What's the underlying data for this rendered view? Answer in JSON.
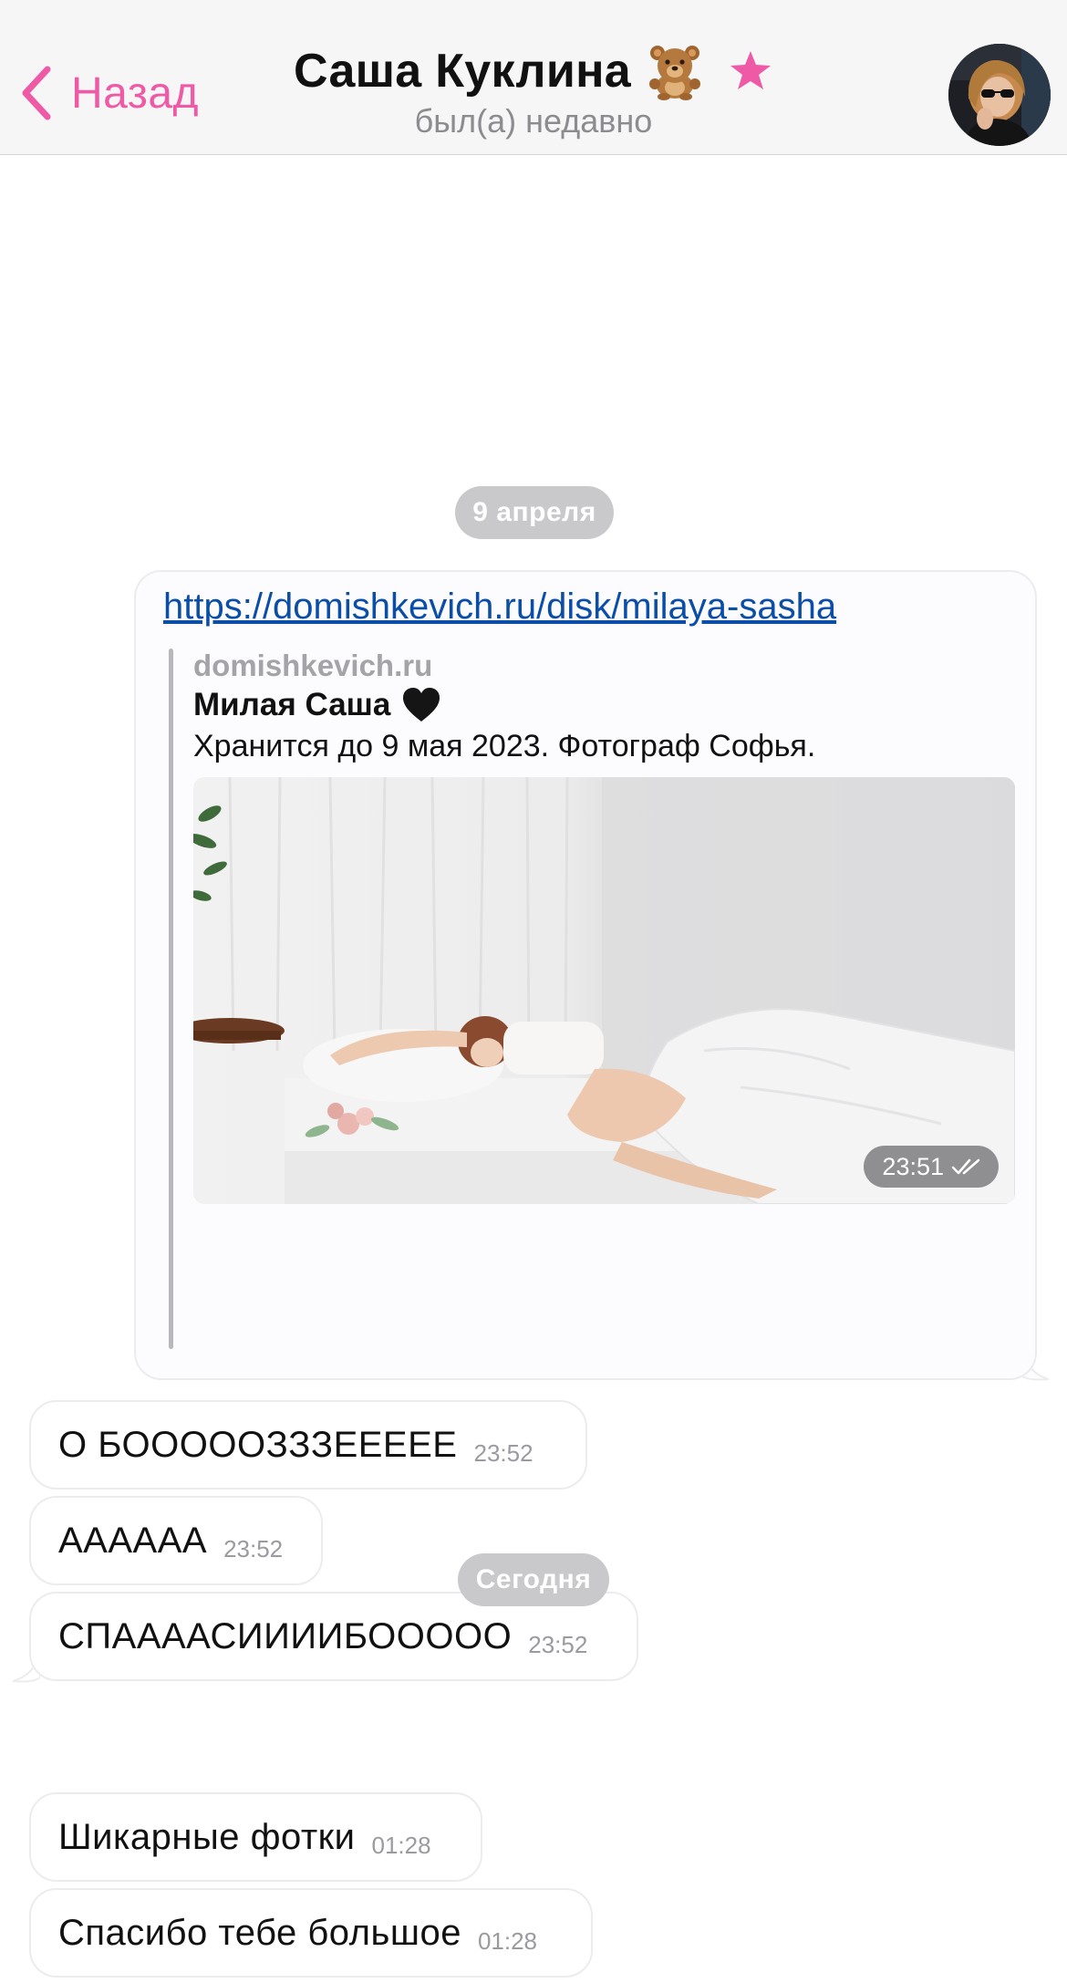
{
  "header": {
    "back_label": "Назад",
    "title": "Саша Куклина",
    "subtitle": "был(а) недавно",
    "title_emoji": "bear-face-icon",
    "status_icon": "star-icon",
    "accent_color": "#ef5aa7"
  },
  "chat": {
    "date_1": "9 апреля",
    "date_2": "Сегодня",
    "link_message": {
      "url": "https://domishkevich.ru/disk/milaya-sasha",
      "site": "domishkevich.ru",
      "preview_title": "Милая Саша",
      "preview_title_emoji": "black-heart-icon",
      "preview_description": "Хранится до 9 мая 2023. Фотограф Софья.",
      "time": "23:51",
      "status": "read"
    },
    "messages": [
      {
        "text": "О БОООООЗЗЗЕЕЕЕЕ",
        "time": "23:52"
      },
      {
        "text": "АААААА",
        "time": "23:52"
      },
      {
        "text": "СПААААСИИИИБООООО",
        "time": "23:52"
      },
      {
        "text": "Шикарные фотки",
        "time": "01:28"
      },
      {
        "text": "Спасибо тебе большое",
        "time": "01:28"
      }
    ]
  }
}
